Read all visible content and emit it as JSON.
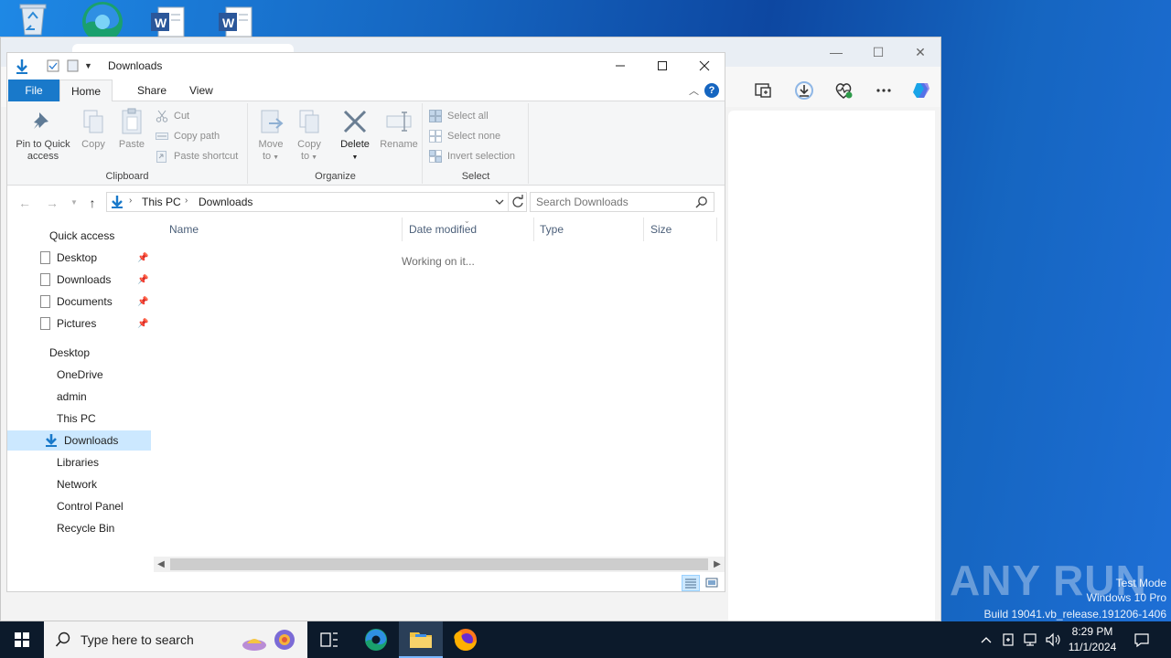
{
  "desktop": {
    "icons": [
      "recycle-bin-icon",
      "edge-icon",
      "word-document-icon",
      "word-document-icon"
    ]
  },
  "browser": {
    "controls": {
      "minimize": "—",
      "maximize": "☐",
      "close": "✕"
    }
  },
  "explorer": {
    "title": "Downloads",
    "ribbon_tabs": {
      "file": "File",
      "home": "Home",
      "share": "Share",
      "view": "View"
    },
    "help": "?",
    "clipboard": {
      "pin_line1": "Pin to Quick",
      "pin_line2": "access",
      "copy": "Copy",
      "paste": "Paste",
      "cut": "Cut",
      "copy_path": "Copy path",
      "paste_shortcut": "Paste shortcut",
      "group_label": "Clipboard"
    },
    "organize": {
      "move_line1": "Move",
      "move_line2": "to",
      "copy_line1": "Copy",
      "copy_line2": "to",
      "delete": "Delete",
      "rename": "Rename",
      "group_label": "Organize"
    },
    "select": {
      "select_all": "Select all",
      "select_none": "Select none",
      "invert": "Invert selection",
      "group_label": "Select"
    },
    "address": {
      "crumbs": [
        "This PC",
        "Downloads"
      ]
    },
    "search": {
      "placeholder": "Search Downloads"
    },
    "nav": {
      "quick_access": "Quick access",
      "quick_items": [
        "Desktop",
        "Downloads",
        "Documents",
        "Pictures"
      ],
      "tree": [
        "Desktop",
        "OneDrive",
        "admin",
        "This PC",
        "Downloads",
        "Libraries",
        "Network",
        "Control Panel",
        "Recycle Bin"
      ]
    },
    "columns": {
      "name": "Name",
      "date_modified": "Date modified",
      "type": "Type",
      "size": "Size"
    },
    "status_text": "Working on it..."
  },
  "watermark": {
    "brand": "ANY RUN",
    "line1": "Test Mode",
    "line2": "Windows 10 Pro",
    "line3": "Build 19041.vb_release.191206-1406"
  },
  "taskbar": {
    "search_placeholder": "Type here to search",
    "time": "8:29 PM",
    "date": "11/1/2024",
    "colors": {
      "accent": "#1979ca",
      "taskbar": "#0c1a2b"
    }
  }
}
